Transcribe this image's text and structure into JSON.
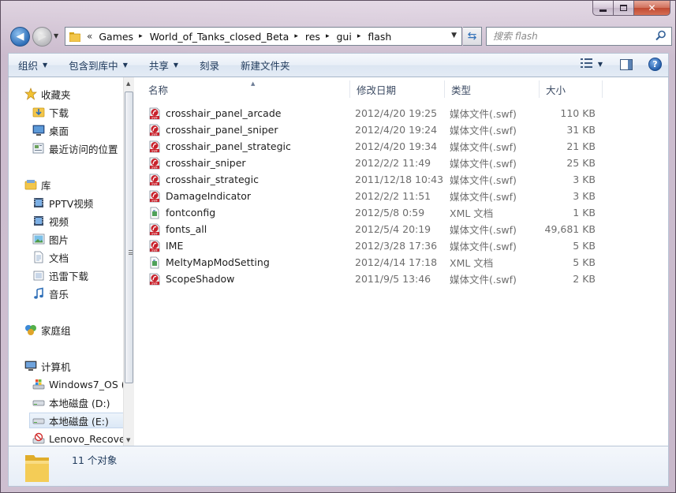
{
  "window": {
    "caption_buttons": {
      "minimize": "minimize",
      "maximize": "maximize",
      "close": "✕"
    }
  },
  "address": {
    "prefix": "«",
    "crumbs": [
      "Games",
      "World_of_Tanks_closed_Beta",
      "res",
      "gui",
      "flash"
    ]
  },
  "search": {
    "placeholder": "搜索 flash"
  },
  "toolbar": {
    "commands": [
      {
        "label": "组织",
        "dropdown": true
      },
      {
        "label": "包含到库中",
        "dropdown": true
      },
      {
        "label": "共享",
        "dropdown": true
      },
      {
        "label": "刻录",
        "dropdown": false
      },
      {
        "label": "新建文件夹",
        "dropdown": false
      }
    ],
    "help_label": "?"
  },
  "nav": {
    "items": [
      {
        "label": "收藏夹",
        "icon": "star-icon",
        "group": true
      },
      {
        "label": "下载",
        "icon": "download-folder-icon"
      },
      {
        "label": "桌面",
        "icon": "desktop-icon"
      },
      {
        "label": "最近访问的位置",
        "icon": "recent-places-icon"
      },
      {
        "label": "库",
        "icon": "library-icon",
        "group": true
      },
      {
        "label": "PPTV视频",
        "icon": "video-library-icon"
      },
      {
        "label": "视频",
        "icon": "video-library-icon"
      },
      {
        "label": "图片",
        "icon": "pictures-library-icon"
      },
      {
        "label": "文档",
        "icon": "documents-library-icon"
      },
      {
        "label": "迅雷下载",
        "icon": "generic-library-icon"
      },
      {
        "label": "音乐",
        "icon": "music-library-icon"
      },
      {
        "label": "家庭组",
        "icon": "homegroup-icon",
        "group": true
      },
      {
        "label": "计算机",
        "icon": "computer-icon",
        "group": true
      },
      {
        "label": "Windows7_OS (",
        "icon": "system-drive-icon"
      },
      {
        "label": "本地磁盘 (D:)",
        "icon": "drive-icon"
      },
      {
        "label": "本地磁盘 (E:)",
        "icon": "drive-icon",
        "selected": true
      },
      {
        "label": "Lenovo_Recove",
        "icon": "recovery-drive-icon"
      }
    ]
  },
  "columns": {
    "name": "名称",
    "date": "修改日期",
    "type": "类型",
    "size": "大小"
  },
  "files": [
    {
      "name": "crosshair_panel_arcade",
      "date": "2012/4/20 19:25",
      "type": "媒体文件(.swf)",
      "size": "110 KB",
      "kind": "swf"
    },
    {
      "name": "crosshair_panel_sniper",
      "date": "2012/4/20 19:24",
      "type": "媒体文件(.swf)",
      "size": "31 KB",
      "kind": "swf"
    },
    {
      "name": "crosshair_panel_strategic",
      "date": "2012/4/20 19:34",
      "type": "媒体文件(.swf)",
      "size": "21 KB",
      "kind": "swf"
    },
    {
      "name": "crosshair_sniper",
      "date": "2012/2/2 11:49",
      "type": "媒体文件(.swf)",
      "size": "25 KB",
      "kind": "swf"
    },
    {
      "name": "crosshair_strategic",
      "date": "2011/12/18 10:43",
      "type": "媒体文件(.swf)",
      "size": "3 KB",
      "kind": "swf"
    },
    {
      "name": "DamageIndicator",
      "date": "2012/2/2 11:51",
      "type": "媒体文件(.swf)",
      "size": "3 KB",
      "kind": "swf"
    },
    {
      "name": "fontconfig",
      "date": "2012/5/8 0:59",
      "type": "XML 文档",
      "size": "1 KB",
      "kind": "xml"
    },
    {
      "name": "fonts_all",
      "date": "2012/5/4 20:19",
      "type": "媒体文件(.swf)",
      "size": "49,681 KB",
      "kind": "swf"
    },
    {
      "name": "IME",
      "date": "2012/3/28 17:36",
      "type": "媒体文件(.swf)",
      "size": "5 KB",
      "kind": "swf"
    },
    {
      "name": "MeltyMapModSetting",
      "date": "2012/4/14 17:18",
      "type": "XML 文档",
      "size": "5 KB",
      "kind": "xml"
    },
    {
      "name": "ScopeShadow",
      "date": "2011/9/5 13:46",
      "type": "媒体文件(.swf)",
      "size": "2 KB",
      "kind": "swf"
    }
  ],
  "details": {
    "count": "11 个对象"
  }
}
